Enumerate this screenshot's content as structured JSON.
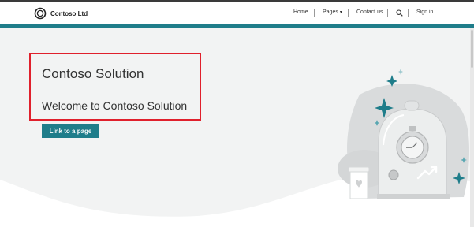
{
  "header": {
    "brand": "Contoso Ltd",
    "nav": {
      "home": "Home",
      "pages": "Pages",
      "contact": "Contact us",
      "signin": "Sign in"
    }
  },
  "hero": {
    "title": "Contoso Solution",
    "subtitle": "Welcome to Contoso Solution",
    "cta": "Link to a page"
  },
  "icons": {
    "logo": "contoso-ring-logo",
    "search": "search-icon",
    "dropdown": "chevron-down-icon",
    "illustration": "stopwatch-bell-jar-illustration"
  },
  "colors": {
    "accent": "#1f7d8a",
    "highlight": "#e0202c"
  }
}
